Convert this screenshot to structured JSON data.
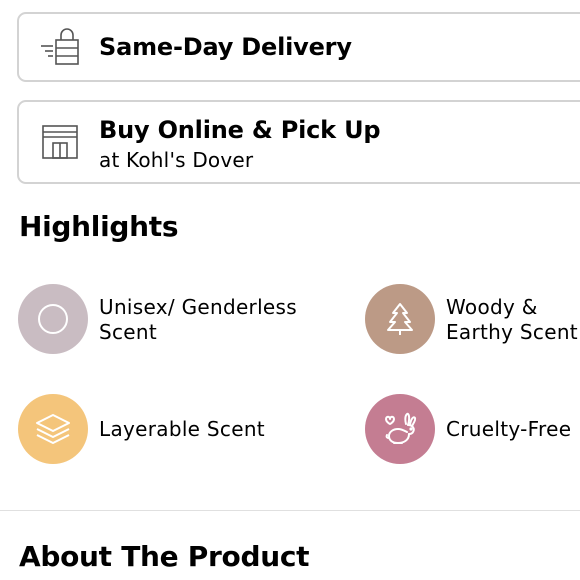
{
  "fulfillment": {
    "same_day": {
      "title": "Same-Day Delivery",
      "icon": "shopping-bag-speed-icon"
    },
    "pickup": {
      "title": "Buy Online & Pick Up",
      "store": "at Kohl's Dover",
      "icon": "store-icon"
    }
  },
  "highlights": {
    "heading": "Highlights",
    "items": [
      {
        "label": "Unisex/ Genderless\nScent",
        "icon": "circle-icon",
        "color": "#c9bcc2"
      },
      {
        "label": "Woody &\nEarthy Scent",
        "icon": "tree-icon",
        "color": "#bc9a86"
      },
      {
        "label": "Layerable Scent",
        "icon": "layers-icon",
        "color": "#f4c57b"
      },
      {
        "label": "Cruelty-Free",
        "icon": "bunny-icon",
        "color": "#c47d92"
      }
    ]
  },
  "about": {
    "heading": "About The Product"
  }
}
